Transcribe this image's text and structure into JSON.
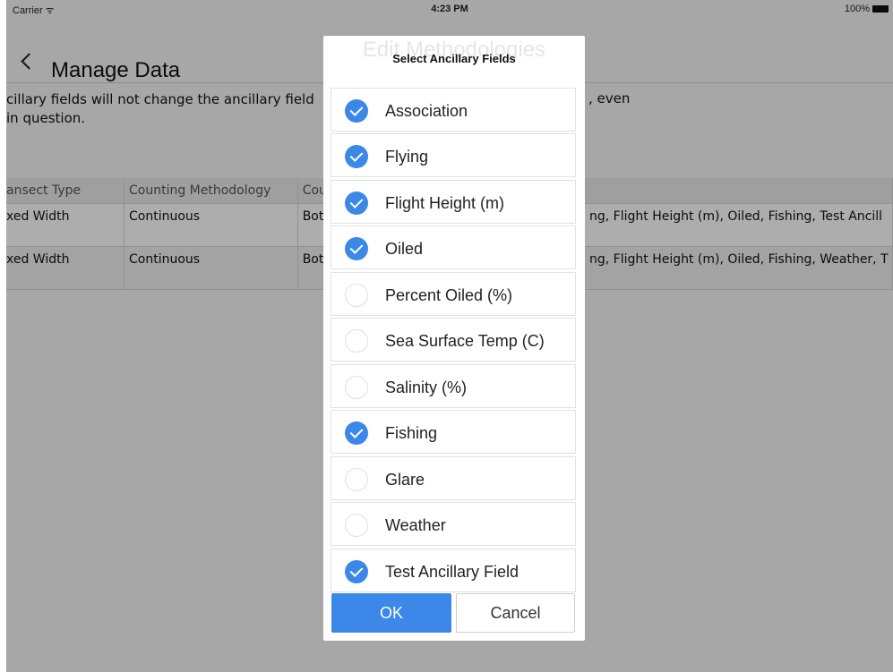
{
  "status_bar": {
    "carrier": "Carrier ᯤ",
    "time": "4:23 PM",
    "battery": "100%"
  },
  "nav": {
    "back_title": "Manage Data",
    "center_title": "Edit Methodologies"
  },
  "description": {
    "line1": "cillary fields will not change the ancillary field",
    "line2": "in question.",
    "line1_tail": ", even"
  },
  "table": {
    "headers": [
      "ansect Type",
      "Counting Methodology",
      "Cou",
      "",
      ""
    ],
    "rows": [
      [
        "xed Width",
        "Continuous",
        "Bot",
        "",
        "ng, Flight Height (m), Oiled, Fishing, Test Ancill"
      ],
      [
        "xed Width",
        "Continuous",
        "Bot",
        "",
        "ng, Flight Height (m), Oiled, Fishing, Weather, T"
      ]
    ]
  },
  "dialog": {
    "title": "Select Ancillary Fields",
    "ghost_title": "Edit Methodologies",
    "items": [
      {
        "label": "Association",
        "checked": true
      },
      {
        "label": "Flying",
        "checked": true
      },
      {
        "label": "Flight Height (m)",
        "checked": true
      },
      {
        "label": "Oiled",
        "checked": true
      },
      {
        "label": "Percent Oiled (%)",
        "checked": false
      },
      {
        "label": "Sea Surface Temp (C)",
        "checked": false
      },
      {
        "label": "Salinity (%)",
        "checked": false
      },
      {
        "label": "Fishing",
        "checked": true
      },
      {
        "label": "Glare",
        "checked": false
      },
      {
        "label": "Weather",
        "checked": false
      },
      {
        "label": "Test Ancillary Field",
        "checked": true
      }
    ],
    "ok_label": "OK",
    "cancel_label": "Cancel"
  },
  "colors": {
    "accent": "#3b88e8",
    "overlay": "rgba(0,0,0,0.32)"
  }
}
